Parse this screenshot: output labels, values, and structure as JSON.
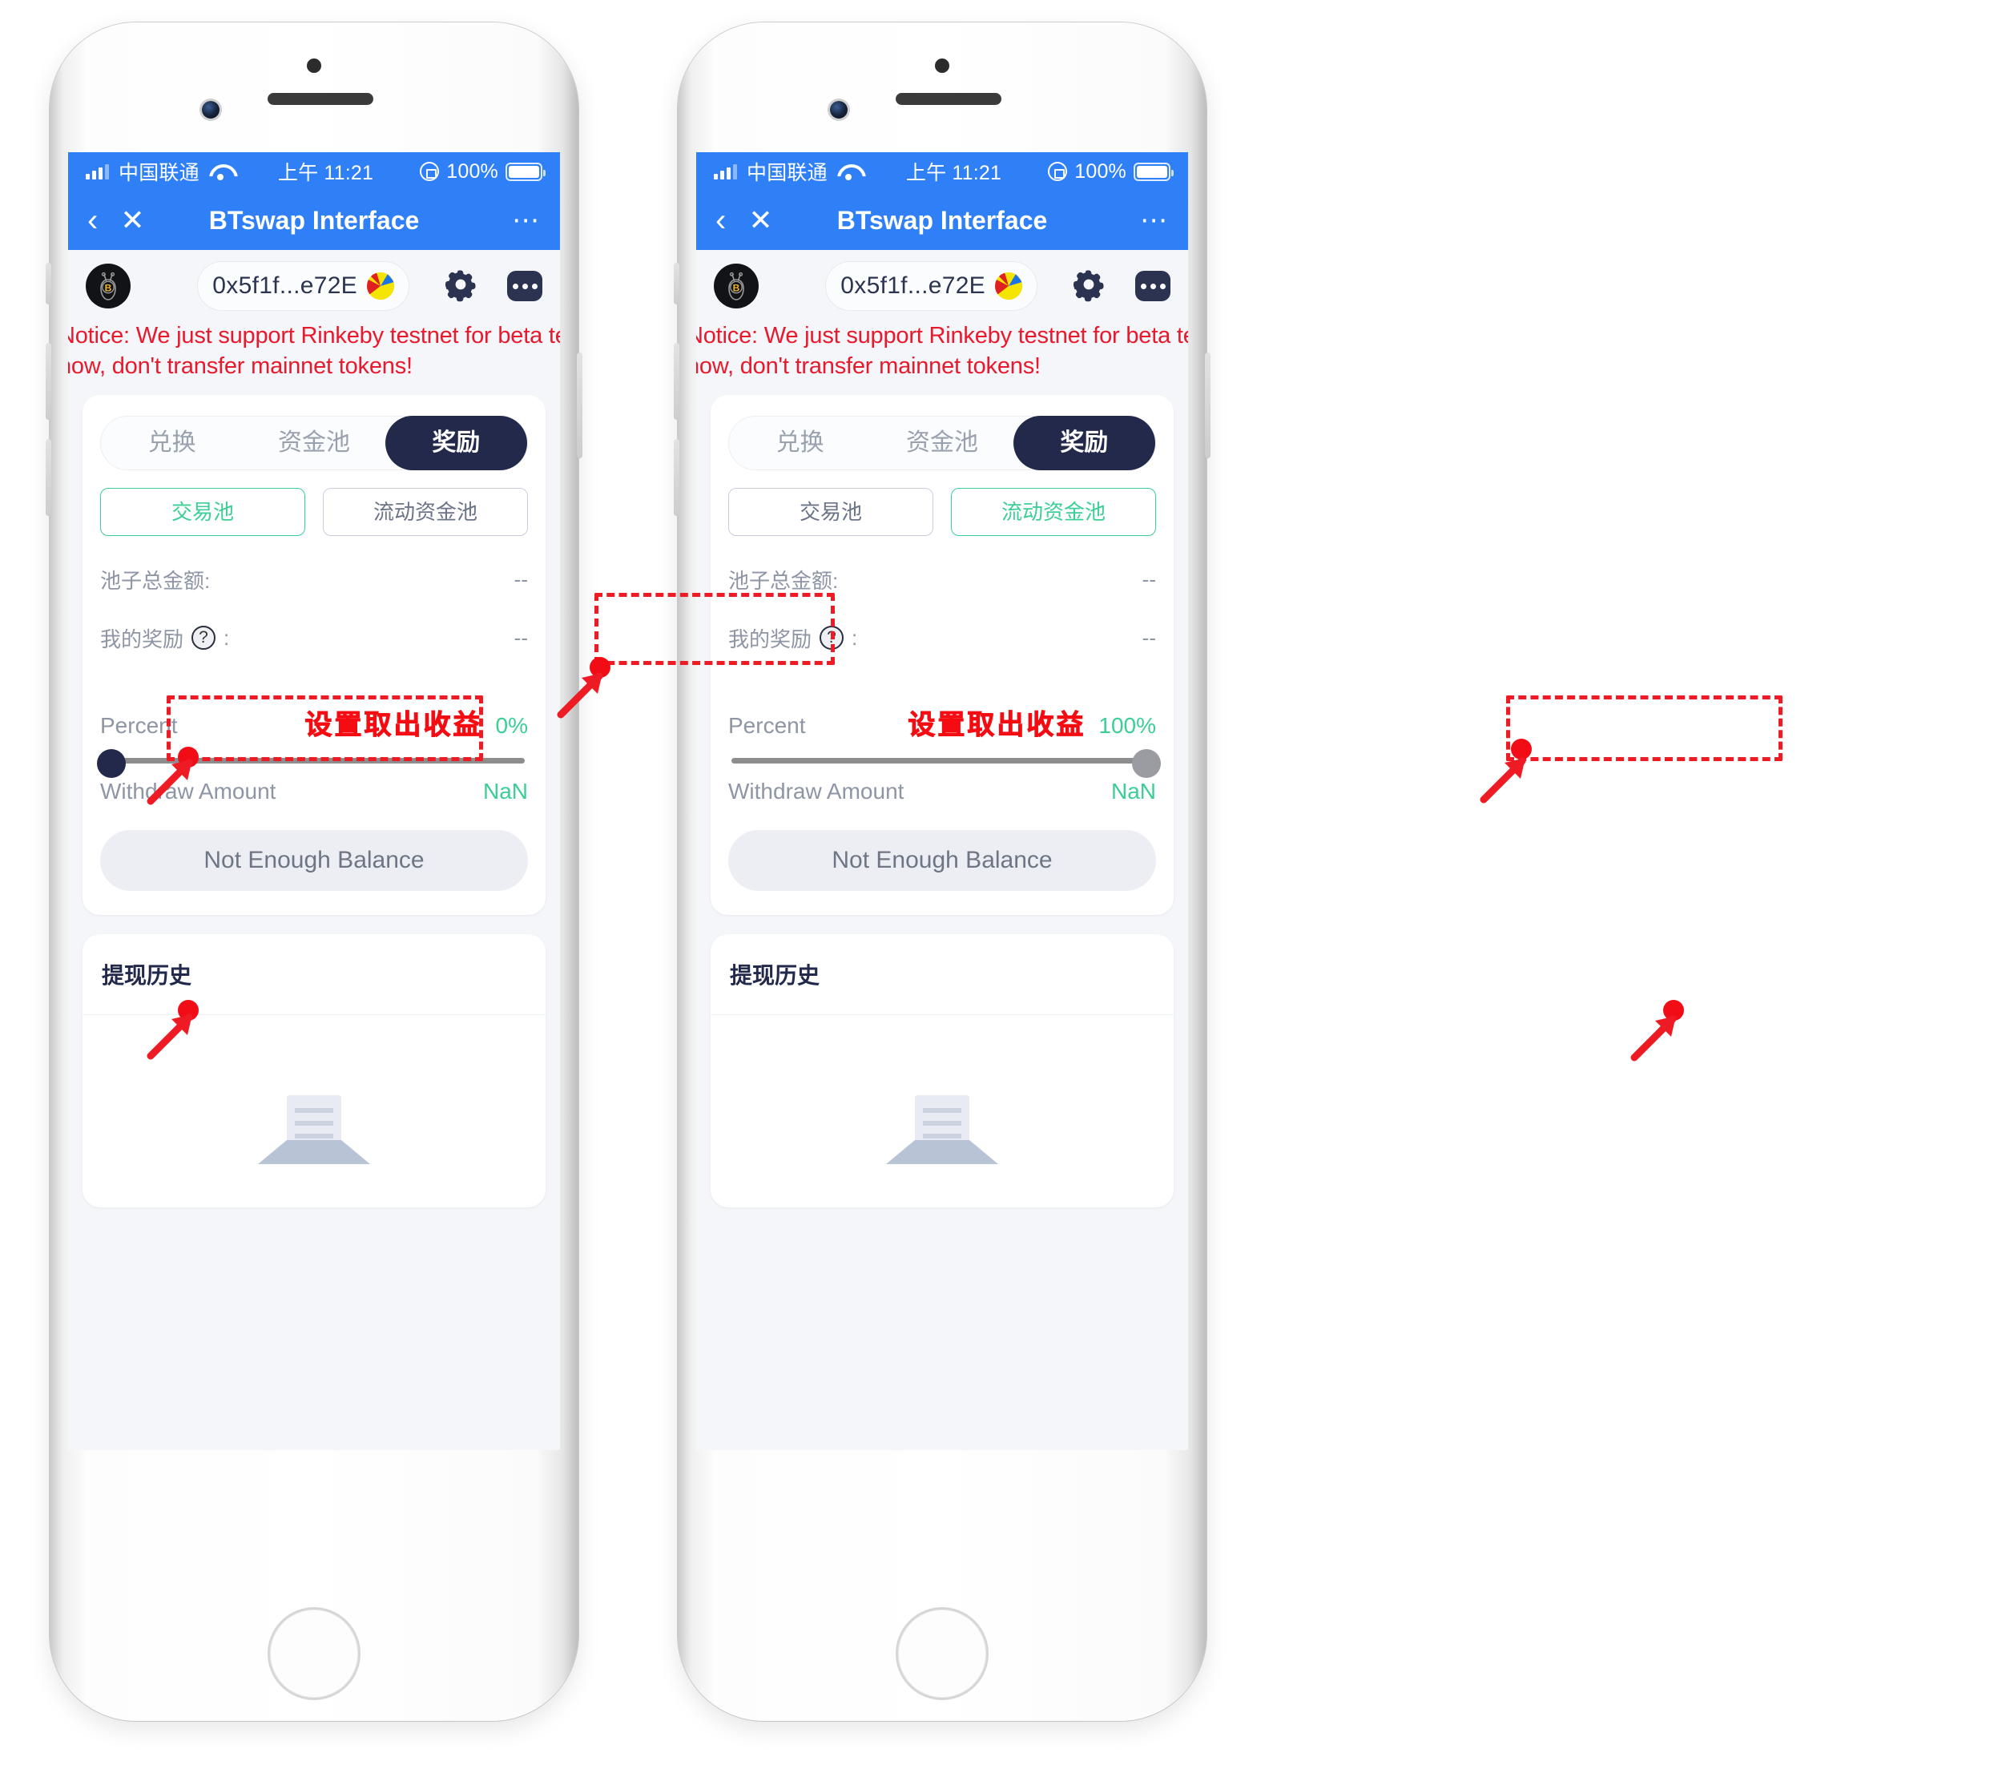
{
  "statusbar": {
    "carrier": "中国联通",
    "time": "上午 11:21",
    "battery_pct": "100%",
    "signal_icon": "signal-bars-icon",
    "wifi_icon": "wifi-icon",
    "rotation_lock_icon": "rotation-lock-icon",
    "battery_icon": "battery-icon"
  },
  "navbar": {
    "back_icon": "chevron-left-icon",
    "close_icon": "close-x-icon",
    "title": "BTswap Interface",
    "more_icon": "ellipsis-icon"
  },
  "appheader": {
    "logo_icon": "btswap-bee-logo-icon",
    "address": "0x5f1f...e72E",
    "avatar_icon": "jazzicon-avatar",
    "settings_icon": "gear-icon",
    "more_icon": "ellipsis-square-icon"
  },
  "notice": {
    "line1": "Notice: We just support Rinkeby testnet for beta test",
    "line2": "now, don't transfer mainnet tokens!",
    "color": "#e8192c"
  },
  "tabs": [
    {
      "label": "兑换",
      "active": false
    },
    {
      "label": "资金池",
      "active": false
    },
    {
      "label": "奖励",
      "active": true
    }
  ],
  "pools_left": [
    {
      "label": "交易池",
      "active": true
    },
    {
      "label": "流动资金池",
      "active": false
    }
  ],
  "pools_right": [
    {
      "label": "交易池",
      "active": false
    },
    {
      "label": "流动资金池",
      "active": true
    }
  ],
  "info": [
    {
      "label": "池子总金额:",
      "value": "--"
    },
    {
      "label": "我的奖励",
      "suffix": ":",
      "help_icon": "question-mark-icon",
      "value": "--"
    }
  ],
  "slider": {
    "label": "Percent",
    "annotation": "设置取出收益",
    "annotation_color": "#f40c12",
    "value_left": "0%",
    "value_right": "100%",
    "value_color": "#3ccf95"
  },
  "withdraw": {
    "label": "Withdraw Amount",
    "value": "NaN",
    "value_color": "#3ccf95"
  },
  "action_button": {
    "label": "Not Enough Balance"
  },
  "history": {
    "title": "提现历史",
    "empty_icon": "empty-document-icon"
  },
  "annotations": {
    "arrow_color": "#ef1b24",
    "dash_color": "#ef1b24",
    "left_targets": [
      "奖励 tab",
      "交易池 button",
      "Percent slider thumb at 0%"
    ],
    "right_targets": [
      "流动资金池 button",
      "Percent slider thumb at 100%"
    ]
  }
}
